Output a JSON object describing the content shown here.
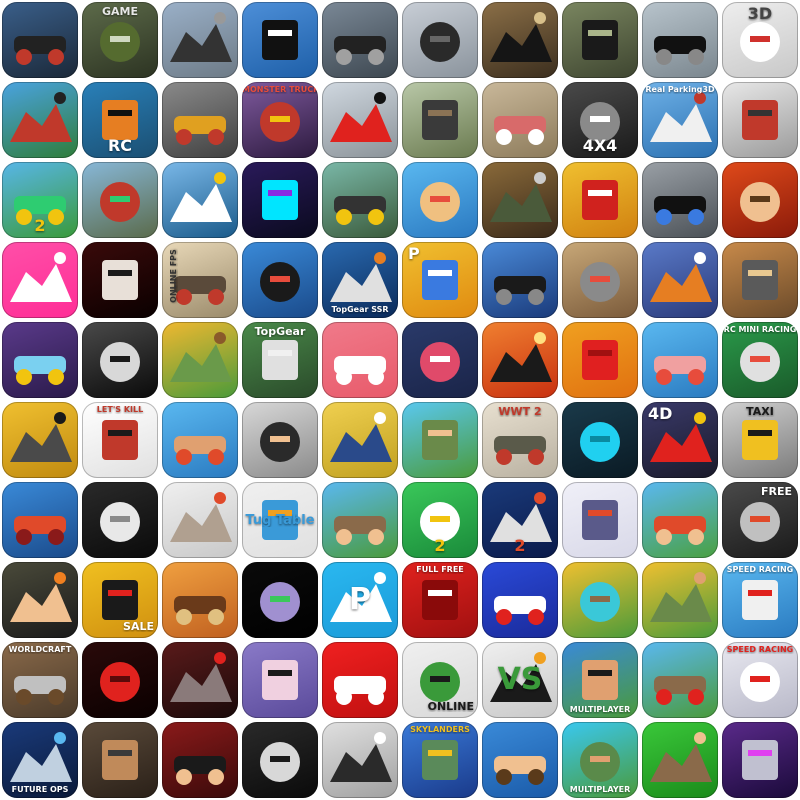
{
  "app_icons": [
    {
      "name": "monster-truck-icon",
      "bg": [
        "#3a5f8a",
        "#1b2838"
      ],
      "fg": "#222222",
      "accent": "#c0392b"
    },
    {
      "name": "army-jeep-game-icon",
      "bg": [
        "#5d6b4a",
        "#2c3322"
      ],
      "fg": "#556b2f",
      "accent": "#cfd8c0",
      "text": "GAME",
      "text_color": "#e8e8e8",
      "text_pos": "top"
    },
    {
      "name": "motorbike-city-icon",
      "bg": [
        "#9ab0c8",
        "#6d7a86"
      ],
      "fg": "#333333",
      "accent": "#999999"
    },
    {
      "name": "police-car-icon",
      "bg": [
        "#4d8fd8",
        "#1e5fa8"
      ],
      "fg": "#111111",
      "accent": "#ffffff"
    },
    {
      "name": "sports-car-road-icon",
      "bg": [
        "#7a8896",
        "#3d4750"
      ],
      "fg": "#222222",
      "accent": "#a0a0a0"
    },
    {
      "name": "motorcycle-rider-icon",
      "bg": [
        "#c8ced6",
        "#8a939c"
      ],
      "fg": "#2a2a2a",
      "accent": "#666666"
    },
    {
      "name": "offroad-car-icon",
      "bg": [
        "#8b6f47",
        "#3b2e1e"
      ],
      "fg": "#151515",
      "accent": "#d8c08a"
    },
    {
      "name": "muscle-car-field-icon",
      "bg": [
        "#7a8660",
        "#3e4530"
      ],
      "fg": "#1a1a1a",
      "accent": "#aab58a"
    },
    {
      "name": "superbike-road-icon",
      "bg": [
        "#b8c4cc",
        "#7a868e"
      ],
      "fg": "#111111",
      "accent": "#888888"
    },
    {
      "name": "white-supercar-3d-2-icon",
      "bg": [
        "#eeeeee",
        "#c8c8c8"
      ],
      "fg": "#ffffff",
      "accent": "#d0312d",
      "text": "3D",
      "text_color": "#444444",
      "text_pos": "top"
    },
    {
      "name": "red-tractor-icon",
      "bg": [
        "#4aa3e0",
        "#2f7d3a"
      ],
      "fg": "#c0392b",
      "accent": "#222222"
    },
    {
      "name": "rc-buggy-icon",
      "bg": [
        "#2980b9",
        "#1b4f72"
      ],
      "fg": "#e67e22",
      "accent": "#111111",
      "text": "RC",
      "text_color": "#ffffff",
      "text_pos": "bottom"
    },
    {
      "name": "gold-racecar-icon",
      "bg": [
        "#8a8a8a",
        "#404040"
      ],
      "fg": "#e0a020",
      "accent": "#c0392b"
    },
    {
      "name": "monster-truck-arena-icon",
      "bg": [
        "#7f5a9e",
        "#2c1a3e"
      ],
      "fg": "#c0392b",
      "accent": "#f1c40f",
      "text": "MONSTER TRUCK",
      "text_color": "#e74c3c",
      "text_pos": "top"
    },
    {
      "name": "red-sportscar-icon",
      "bg": [
        "#d0d8e0",
        "#8a9298"
      ],
      "fg": "#e0221e",
      "accent": "#111111"
    },
    {
      "name": "offroad-desert-icon",
      "bg": [
        "#b9c8a8",
        "#6a7a4f"
      ],
      "fg": "#3a3a3a",
      "accent": "#8b7355"
    },
    {
      "name": "classic-car-icon",
      "bg": [
        "#c9b89a",
        "#8c7a5a"
      ],
      "fg": "#d86a6a",
      "accent": "#ffffff"
    },
    {
      "name": "4x4-truck-3d-icon",
      "bg": [
        "#4a4a4a",
        "#1a1a1a"
      ],
      "fg": "#8a8a8a",
      "accent": "#ffffff",
      "text": "4X4",
      "text_color": "#ffffff",
      "text_pos": "bottom"
    },
    {
      "name": "real-parking-3d-icon",
      "bg": [
        "#6fb2e8",
        "#2a6fb0"
      ],
      "fg": "#f0f0f0",
      "accent": "#c0392b",
      "text": "Real Parking3D",
      "text_color": "#ffffff",
      "text_pos": "top"
    },
    {
      "name": "moto-battle-icon",
      "bg": [
        "#e8e8e8",
        "#9a9a9a"
      ],
      "fg": "#c0392b",
      "accent": "#333333"
    },
    {
      "name": "hill-racer-2-icon",
      "bg": [
        "#58b6e8",
        "#3a9a3a"
      ],
      "fg": "#2ecc71",
      "accent": "#f1c40f",
      "text": "2",
      "text_color": "#f1c40f",
      "text_pos": "bottom"
    },
    {
      "name": "tank-race-icon",
      "bg": [
        "#88b8d8",
        "#5a6a4a"
      ],
      "fg": "#c0392b",
      "accent": "#2ecc71"
    },
    {
      "name": "speedboat-icon",
      "bg": [
        "#7ab8e8",
        "#1a5a8a"
      ],
      "fg": "#ffffff",
      "accent": "#f1c40f"
    },
    {
      "name": "neon-rider-icon",
      "bg": [
        "#2a1a5a",
        "#0a0a1e"
      ],
      "fg": "#00e5ff",
      "accent": "#8a2be2"
    },
    {
      "name": "highway-drive-icon",
      "bg": [
        "#7ab8a8",
        "#3a5a3a"
      ],
      "fg": "#333333",
      "accent": "#f1c40f"
    },
    {
      "name": "kart-kid-icon",
      "bg": [
        "#5ab8f0",
        "#2a78c0"
      ],
      "fg": "#f0c080",
      "accent": "#e74c3c"
    },
    {
      "name": "offroad-jeep-icon",
      "bg": [
        "#8a6a3a",
        "#3a2a1a"
      ],
      "fg": "#4a5a3a",
      "accent": "#cccccc"
    },
    {
      "name": "fire-truck-icon",
      "bg": [
        "#f0c030",
        "#d08010"
      ],
      "fg": "#d0221e",
      "accent": "#ffffff"
    },
    {
      "name": "police-chase-icon",
      "bg": [
        "#9aa0a6",
        "#4a5056"
      ],
      "fg": "#111111",
      "accent": "#3a7ae0"
    },
    {
      "name": "sword-warrior-icon",
      "bg": [
        "#e04a1a",
        "#8a1a0a"
      ],
      "fg": "#f0c090",
      "accent": "#5a3a1a"
    },
    {
      "name": "pink-abstract-icon",
      "bg": [
        "#ff4fa8",
        "#ff2d96"
      ],
      "fg": "#ffffff",
      "accent": "#ffffff"
    },
    {
      "name": "slender-man-icon",
      "bg": [
        "#3a0a0a",
        "#0a0000"
      ],
      "fg": "#e8e0d8",
      "accent": "#1a1a1a"
    },
    {
      "name": "online-fps-icon",
      "bg": [
        "#e8d8b8",
        "#9a8a6a"
      ],
      "fg": "#5a4a3a",
      "accent": "#c0392b",
      "text": "ONLINE FPS",
      "text_color": "#333333",
      "text_pos": "side"
    },
    {
      "name": "monster-truck-blue-icon",
      "bg": [
        "#3a8ad8",
        "#1a4a8a"
      ],
      "fg": "#1a1a1a",
      "accent": "#e74c3c"
    },
    {
      "name": "topgear-ssr-icon",
      "bg": [
        "#2a6ab0",
        "#0a2a5a"
      ],
      "fg": "#e0e0e0",
      "accent": "#e67e22",
      "text": "TopGear SSR",
      "text_color": "#ffffff",
      "text_pos": "bottom"
    },
    {
      "name": "parking-buggy-icon",
      "bg": [
        "#f0c030",
        "#e08a10"
      ],
      "fg": "#3a7ae0",
      "accent": "#ffffff",
      "text": "P",
      "text_color": "#ffffff",
      "text_pos": "topleft"
    },
    {
      "name": "bat-bike-icon",
      "bg": [
        "#4a8ad8",
        "#1a3a7a"
      ],
      "fg": "#1a1a1a",
      "accent": "#888888"
    },
    {
      "name": "battle-cars-icon",
      "bg": [
        "#c8a878",
        "#7a5a3a"
      ],
      "fg": "#8a8a8a",
      "accent": "#e74c3c"
    },
    {
      "name": "stunt-bike-icon",
      "bg": [
        "#5a7ac8",
        "#2a3a7a"
      ],
      "fg": "#e67e22",
      "accent": "#ffffff"
    },
    {
      "name": "desert-buggy-icon",
      "bg": [
        "#c88a4a",
        "#6a4a2a"
      ],
      "fg": "#5a5a5a",
      "accent": "#e8c890"
    },
    {
      "name": "pixel-robot-icon",
      "bg": [
        "#5a3a8a",
        "#2a1a4a"
      ],
      "fg": "#7ad0f0",
      "accent": "#f1c40f"
    },
    {
      "name": "horror-mask-icon",
      "bg": [
        "#4a4a4a",
        "#0a0a0a"
      ],
      "fg": "#d8d8d8",
      "accent": "#1a1a1a"
    },
    {
      "name": "blocky-zombie-icon",
      "bg": [
        "#f0b830",
        "#4a9a3a"
      ],
      "fg": "#6a9a4a",
      "accent": "#8a5a2a"
    },
    {
      "name": "topgear-caravan-icon",
      "bg": [
        "#4a8a4a",
        "#2a4a2a"
      ],
      "fg": "#e0e0e0",
      "accent": "#f0f0f0",
      "text": "TopGear",
      "text_color": "#ffffff",
      "text_pos": "top"
    },
    {
      "name": "pink-face-icon",
      "bg": [
        "#f07a8a",
        "#e85a6a"
      ],
      "fg": "#ffffff",
      "accent": "#ffffff"
    },
    {
      "name": "target-circle-icon",
      "bg": [
        "#2a3a6a",
        "#1a2448"
      ],
      "fg": "#e04a6a",
      "accent": "#ffffff"
    },
    {
      "name": "rocket-launch-icon",
      "bg": [
        "#f08030",
        "#c83010"
      ],
      "fg": "#1a1a1a",
      "accent": "#ffe080"
    },
    {
      "name": "red-cube-icon",
      "bg": [
        "#f0a020",
        "#e07010"
      ],
      "fg": "#e02020",
      "accent": "#a01010"
    },
    {
      "name": "pig-kart-icon",
      "bg": [
        "#5ab8f0",
        "#2a7ac0"
      ],
      "fg": "#f0a0a0",
      "accent": "#e74c3c"
    },
    {
      "name": "rc-mini-racing-icon",
      "bg": [
        "#2a9a4a",
        "#1a5a2a"
      ],
      "fg": "#e0e0e0",
      "accent": "#e74c3c",
      "text": "RC MINI RACING",
      "text_color": "#ffffff",
      "text_pos": "top"
    },
    {
      "name": "soldier-gunner-icon",
      "bg": [
        "#f0c030",
        "#c08a10"
      ],
      "fg": "#4a4a4a",
      "accent": "#1a1a1a"
    },
    {
      "name": "lets-kill-jeff-icon",
      "bg": [
        "#ffffff",
        "#e0e0e0"
      ],
      "fg": "#c0392b",
      "accent": "#1a1a1a",
      "text": "LET'S KILL",
      "text_color": "#c0392b",
      "text_pos": "top"
    },
    {
      "name": "blocky-brawler-icon",
      "bg": [
        "#5ab8f0",
        "#2a7ac0"
      ],
      "fg": "#e0a070",
      "accent": "#e04a2a"
    },
    {
      "name": "blocky-agent-icon",
      "bg": [
        "#d8d8d8",
        "#8a8a8a"
      ],
      "fg": "#2a2a2a",
      "accent": "#f0c090"
    },
    {
      "name": "blocky-police-prison-icon",
      "bg": [
        "#f0d050",
        "#c0a020"
      ],
      "fg": "#2a4a8a",
      "accent": "#ffffff"
    },
    {
      "name": "blocky-gunner-icon",
      "bg": [
        "#5ac8f0",
        "#4a9a3a"
      ],
      "fg": "#6a8a4a",
      "accent": "#f0c090"
    },
    {
      "name": "ww-tanks-2-icon",
      "bg": [
        "#e8e0d0",
        "#b8b0a0"
      ],
      "fg": "#5a5a4a",
      "accent": "#c0392b",
      "text": "WWT 2",
      "text_color": "#c0392b",
      "text_pos": "top"
    },
    {
      "name": "neon-shard-icon",
      "bg": [
        "#1a3a4a",
        "#0a1a24"
      ],
      "fg": "#20d0f0",
      "accent": "#0a8aa0"
    },
    {
      "name": "red-supercar-4d-icon",
      "bg": [
        "#3a3a6a",
        "#1a1a2a"
      ],
      "fg": "#e0221e",
      "accent": "#f1c40f",
      "text": "4D",
      "text_color": "#ffffff",
      "text_pos": "topleft"
    },
    {
      "name": "taxi-driver-icon",
      "bg": [
        "#d0d0d0",
        "#7a7a7a"
      ],
      "fg": "#f0c020",
      "accent": "#1a1a1a",
      "text": "TAXI",
      "text_color": "#1a1a1a",
      "text_pos": "top"
    },
    {
      "name": "red-blocky-robot-icon",
      "bg": [
        "#3a8ad8",
        "#1a4a8a"
      ],
      "fg": "#e04a2a",
      "accent": "#8a1a1a"
    },
    {
      "name": "goat-simulator-icon",
      "bg": [
        "#2a2a2a",
        "#0a0a0a"
      ],
      "fg": "#e8e8e8",
      "accent": "#8a8a8a"
    },
    {
      "name": "cat-gunner-icon",
      "bg": [
        "#f0f0f0",
        "#c8c8c8"
      ],
      "fg": "#b0a090",
      "accent": "#e04a2a"
    },
    {
      "name": "tug-table-icon",
      "bg": [
        "#f0f0f0",
        "#e0e0e0"
      ],
      "fg": "#3a9ad8",
      "accent": "#f0a020",
      "text": "Tug Table",
      "text_color": "#3a9ad8",
      "text_pos": "center"
    },
    {
      "name": "blocky-hunter-icon",
      "bg": [
        "#5ab8f0",
        "#4a9a3a"
      ],
      "fg": "#8a6a4a",
      "accent": "#f0c090"
    },
    {
      "name": "stickman-fight-2-icon",
      "bg": [
        "#3ac85a",
        "#1a8a3a"
      ],
      "fg": "#ffffff",
      "accent": "#f1c40f",
      "text": "2",
      "text_color": "#f1c40f",
      "text_pos": "bottom"
    },
    {
      "name": "naval-anchors-2-icon",
      "bg": [
        "#1a3a7a",
        "#0a1a4a"
      ],
      "fg": "#e0e0e0",
      "accent": "#e04a2a",
      "text": "2",
      "text_color": "#e04a2a",
      "text_pos": "bottom"
    },
    {
      "name": "battleship-sketch-icon",
      "bg": [
        "#f0f0f8",
        "#d8d8e8"
      ],
      "fg": "#5a5a8a",
      "accent": "#e04a2a"
    },
    {
      "name": "blocky-kid-icon",
      "bg": [
        "#5ab8f0",
        "#4aa040"
      ],
      "fg": "#e04a2a",
      "accent": "#f0c090"
    },
    {
      "name": "free-moto-racing-icon",
      "bg": [
        "#4a4a4a",
        "#1a1a1a"
      ],
      "fg": "#c0c0c0",
      "accent": "#e04a2a",
      "text": "FREE",
      "text_color": "#ffffff",
      "text_pos": "topright"
    },
    {
      "name": "burning-hand-icon",
      "bg": [
        "#4a4a3a",
        "#1a1a1a"
      ],
      "fg": "#f0c090",
      "accent": "#f08020"
    },
    {
      "name": "radiation-sale-icon",
      "bg": [
        "#f0c020",
        "#d09010"
      ],
      "fg": "#1a1a1a",
      "accent": "#e0221e",
      "text": "SALE",
      "text_color": "#ffffff",
      "text_pos": "bottomright"
    },
    {
      "name": "barbarian-warrior-icon",
      "bg": [
        "#f0a040",
        "#c06020"
      ],
      "fg": "#6a3a1a",
      "accent": "#e0c080"
    },
    {
      "name": "space-orbs-icon",
      "bg": [
        "#0a0a0a",
        "#000000"
      ],
      "fg": "#a090d0",
      "accent": "#3ac85a"
    },
    {
      "name": "parking-p-icon",
      "bg": [
        "#2ab8f0",
        "#1a9ad8"
      ],
      "fg": "#ffffff",
      "accent": "#ffffff",
      "text": "P",
      "text_color": "#ffffff",
      "text_pos": "center"
    },
    {
      "name": "red-block-face-icon",
      "bg": [
        "#e0221e",
        "#a01010"
      ],
      "fg": "#8a0a0a",
      "accent": "#ffffff",
      "text": "FULL FREE",
      "text_color": "#ffffff",
      "text_pos": "top"
    },
    {
      "name": "domino-tiles-icon",
      "bg": [
        "#2a4ad8",
        "#1a2a9a"
      ],
      "fg": "#ffffff",
      "accent": "#e0221e"
    },
    {
      "name": "blocky-sniper-icon",
      "bg": [
        "#f0c030",
        "#4a9a3a"
      ],
      "fg": "#3ac8d8",
      "accent": "#8a6a4a"
    },
    {
      "name": "blocky-soldiers-icon",
      "bg": [
        "#f0c030",
        "#4a9a3a"
      ],
      "fg": "#6a8a4a",
      "accent": "#e0a070"
    },
    {
      "name": "speed-racing-ultimate-icon",
      "bg": [
        "#5ab8f0",
        "#2a7ac0"
      ],
      "fg": "#f0f0f0",
      "accent": "#e0221e",
      "text": "SPEED RACING",
      "text_color": "#ffffff",
      "text_pos": "top"
    },
    {
      "name": "worldcraft-icon",
      "bg": [
        "#8a6a4a",
        "#4a3a2a"
      ],
      "fg": "#c0c0c0",
      "accent": "#6a4a2a",
      "text": "WORLDCRAFT",
      "text_color": "#ffffff",
      "text_pos": "top"
    },
    {
      "name": "horror-face-icon",
      "bg": [
        "#2a0a0a",
        "#0a0000"
      ],
      "fg": "#e0221e",
      "accent": "#5a0a0a"
    },
    {
      "name": "zombie-dinosaur-icon",
      "bg": [
        "#5a1a1a",
        "#1a0a0a"
      ],
      "fg": "#8a7a7a",
      "accent": "#e0221e"
    },
    {
      "name": "kawaii-blob-icon",
      "bg": [
        "#8a7ac8",
        "#5a4a9a"
      ],
      "fg": "#f0d0e0",
      "accent": "#1a1a1a"
    },
    {
      "name": "red-parkour-icon",
      "bg": [
        "#f02020",
        "#c01010"
      ],
      "fg": "#ffffff",
      "accent": "#ffffff"
    },
    {
      "name": "raptors-online-icon",
      "bg": [
        "#f0f0f0",
        "#d8d8d8"
      ],
      "fg": "#3a9a3a",
      "accent": "#1a1a1a",
      "text": "ONLINE",
      "text_color": "#1a1a1a",
      "text_pos": "bottomright"
    },
    {
      "name": "bomb-vs-icon",
      "bg": [
        "#f0f0f0",
        "#c8c8c8"
      ],
      "fg": "#1a1a1a",
      "accent": "#f0a020",
      "text": "VS",
      "text_color": "#3a9a3a",
      "text_pos": "center"
    },
    {
      "name": "multiplayer-creative-shooter-icon",
      "bg": [
        "#3a8ad8",
        "#4a9a3a"
      ],
      "fg": "#e0a070",
      "accent": "#1a1a1a",
      "text": "MULTIPLAYER",
      "text_color": "#ffffff",
      "text_pos": "bottom"
    },
    {
      "name": "blocky-sword-icon",
      "bg": [
        "#5ab8f0",
        "#4a9a3a"
      ],
      "fg": "#8a6a4a",
      "accent": "#e0221e"
    },
    {
      "name": "speed-racing-free-icon",
      "bg": [
        "#e8e8f0",
        "#b8b8c8"
      ],
      "fg": "#ffffff",
      "accent": "#e0221e",
      "text": "SPEED RACING",
      "text_color": "#e0221e",
      "text_pos": "top"
    },
    {
      "name": "future-ops-online-icon",
      "bg": [
        "#1a3a7a",
        "#0a1a3a"
      ],
      "fg": "#c0d0e0",
      "accent": "#5ab8f0",
      "text": "FUTURE OPS",
      "text_color": "#ffffff",
      "text_pos": "bottom"
    },
    {
      "name": "blocky-survivor-icon",
      "bg": [
        "#5a4a3a",
        "#2a2018"
      ],
      "fg": "#c08a5a",
      "accent": "#3a3a3a"
    },
    {
      "name": "agent-bat-icon",
      "bg": [
        "#8a1a1a",
        "#3a0a0a"
      ],
      "fg": "#1a1a1a",
      "accent": "#f0c090"
    },
    {
      "name": "slender-suit-icon",
      "bg": [
        "#2a2a2a",
        "#0a0a0a"
      ],
      "fg": "#d8d8d8",
      "accent": "#1a1a1a"
    },
    {
      "name": "husky-puppy-icon",
      "bg": [
        "#e0e0e0",
        "#a0a0a0"
      ],
      "fg": "#2a2a2a",
      "accent": "#ffffff"
    },
    {
      "name": "skylanders-icon",
      "bg": [
        "#3a7ad8",
        "#1a3a8a"
      ],
      "fg": "#5a8a5a",
      "accent": "#f0c020",
      "text": "SKYLANDERS",
      "text_color": "#f0c020",
      "text_pos": "top"
    },
    {
      "name": "bowling-boy-icon",
      "bg": [
        "#3a8ad8",
        "#1a5aa8"
      ],
      "fg": "#f0c090",
      "accent": "#5a3a1a"
    },
    {
      "name": "multiplayer-shooter-icon",
      "bg": [
        "#3ac8f0",
        "#4a9a3a"
      ],
      "fg": "#5a8a4a",
      "accent": "#e0a070",
      "text": "MULTIPLAYER",
      "text_color": "#ffffff",
      "text_pos": "bottom"
    },
    {
      "name": "blocky-swordsman-icon",
      "bg": [
        "#3ac83a",
        "#1a8a1a"
      ],
      "fg": "#8a6a4a",
      "accent": "#f0c090"
    },
    {
      "name": "night-moto-icon",
      "bg": [
        "#5a2a8a",
        "#1a0a3a"
      ],
      "fg": "#c0c0d0",
      "accent": "#e040f0"
    }
  ]
}
